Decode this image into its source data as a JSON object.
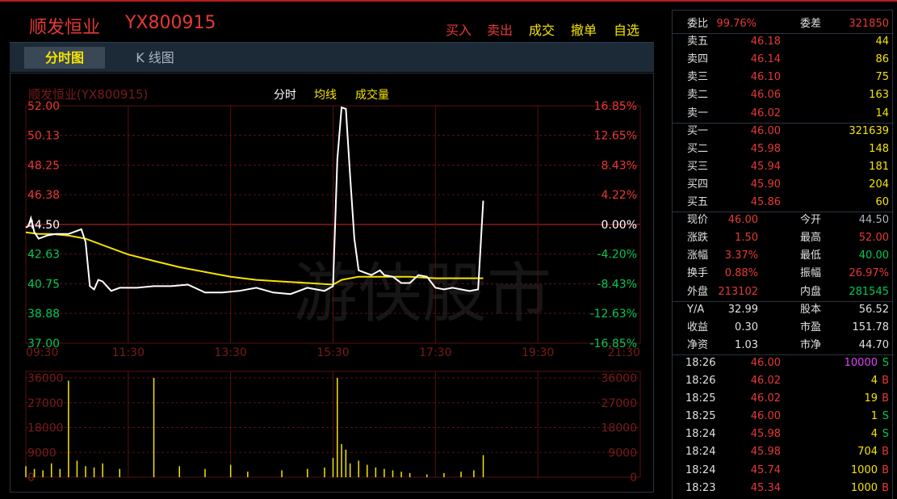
{
  "header": {
    "stock_name": "顺发恒业",
    "stock_code": "YX800915",
    "buttons": [
      {
        "label": "买入",
        "color": "#e53935"
      },
      {
        "label": "卖出",
        "color": "#e53935"
      },
      {
        "label": "成交",
        "color": "#f5e400"
      },
      {
        "label": "撤单",
        "color": "#f5e400"
      },
      {
        "label": "自选",
        "color": "#f5e400"
      }
    ]
  },
  "tabs": [
    {
      "label": "分时图",
      "active": true
    },
    {
      "label": "K 线图",
      "active": false
    }
  ],
  "chart": {
    "watermark_title": "顺发恒业(YX800915)",
    "legend": {
      "time": "分时",
      "avg": "均线",
      "volume": "成交量"
    },
    "background_watermark": "游侠股市",
    "price_ticks": [
      "52.00",
      "50.13",
      "48.25",
      "46.38",
      "44.50",
      "42.63",
      "40.75",
      "38.88",
      "37.00"
    ],
    "pct_ticks": [
      "16.85%",
      "12.65%",
      "8.43%",
      "4.22%",
      "0.00%",
      "-4.20%",
      "-8.43%",
      "-12.63%",
      "-16.85%"
    ],
    "time_ticks": [
      "09:30",
      "11:30",
      "13:30",
      "15:30",
      "17:30",
      "19:30",
      "21:30"
    ],
    "volume_ticks": [
      "36000",
      "27000",
      "18000",
      "9000",
      "0"
    ],
    "colors": {
      "up": "#e53935",
      "down": "#00c853",
      "price_line": "#ffffff",
      "avg_line": "#f5e400",
      "grid": "#5a1010"
    }
  },
  "chart_data": {
    "type": "line",
    "title": "",
    "xlabel": "",
    "ylabel": "",
    "prev_close": 44.5,
    "ylim": [
      37.0,
      52.0
    ],
    "x_range": [
      "09:30",
      "21:30"
    ],
    "series": [
      {
        "name": "分时",
        "x": [
          "09:30",
          "09:33",
          "09:36",
          "09:40",
          "09:45",
          "09:55",
          "10:05",
          "10:20",
          "10:35",
          "10:40",
          "10:45",
          "10:50",
          "10:55",
          "11:00",
          "11:10",
          "11:20",
          "11:40",
          "12:00",
          "12:20",
          "12:40",
          "13:00",
          "13:20",
          "13:40",
          "14:00",
          "14:20",
          "14:40",
          "15:00",
          "15:20",
          "15:30",
          "15:35",
          "15:40",
          "15:45",
          "15:50",
          "15:55",
          "16:00",
          "16:05",
          "16:15",
          "16:25",
          "16:30",
          "16:40",
          "16:50",
          "17:00",
          "17:10",
          "17:20",
          "17:30",
          "17:40",
          "17:50",
          "18:00",
          "18:10",
          "18:20",
          "18:26"
        ],
        "values": [
          44.3,
          44.4,
          44.9,
          44.0,
          43.6,
          43.8,
          43.9,
          43.9,
          44.2,
          43.4,
          40.6,
          40.4,
          41.0,
          40.9,
          40.3,
          40.5,
          40.5,
          40.6,
          40.6,
          40.7,
          40.2,
          40.2,
          40.3,
          40.5,
          40.2,
          40.1,
          40.5,
          40.3,
          40.6,
          48.6,
          51.9,
          51.8,
          47.6,
          43.6,
          41.6,
          41.5,
          41.3,
          41.6,
          41.3,
          41.2,
          40.8,
          40.8,
          41.3,
          41.2,
          40.5,
          40.4,
          40.5,
          40.4,
          40.3,
          40.4,
          46.0
        ]
      },
      {
        "name": "均线",
        "x": [
          "09:30",
          "09:45",
          "10:00",
          "10:20",
          "10:40",
          "11:00",
          "11:30",
          "12:00",
          "12:30",
          "13:00",
          "13:30",
          "14:00",
          "14:30",
          "15:00",
          "15:30",
          "15:40",
          "16:00",
          "16:30",
          "17:00",
          "17:30",
          "18:00",
          "18:26"
        ],
        "values": [
          44.0,
          43.9,
          43.9,
          43.8,
          43.6,
          43.2,
          42.6,
          42.2,
          41.8,
          41.5,
          41.2,
          41.0,
          40.9,
          40.8,
          40.7,
          41.0,
          41.2,
          41.2,
          41.2,
          41.1,
          41.1,
          41.1
        ]
      }
    ],
    "volume": {
      "ylim": [
        0,
        36000
      ],
      "x": [
        "09:30",
        "09:40",
        "09:50",
        "10:00",
        "10:10",
        "10:20",
        "10:30",
        "10:40",
        "10:50",
        "11:00",
        "11:20",
        "12:00",
        "12:30",
        "13:00",
        "13:30",
        "13:50",
        "14:30",
        "15:00",
        "15:20",
        "15:30",
        "15:35",
        "15:40",
        "15:45",
        "15:50",
        "16:00",
        "16:10",
        "16:20",
        "16:30",
        "16:40",
        "16:50",
        "17:00",
        "17:20",
        "17:40",
        "18:00",
        "18:15",
        "18:26"
      ],
      "values": [
        4000,
        3000,
        2500,
        5000,
        3000,
        35000,
        6000,
        4000,
        3500,
        5000,
        3000,
        36000,
        4000,
        3000,
        4500,
        2000,
        2500,
        3000,
        3500,
        7000,
        36000,
        12000,
        10000,
        5000,
        6000,
        4500,
        3500,
        3000,
        2500,
        2000,
        1500,
        1000,
        1500,
        2000,
        2500,
        8000
      ]
    }
  },
  "order_book": {
    "committee": {
      "ratio_label": "委比",
      "ratio": "99.76%",
      "diff_label": "委差",
      "diff": "321850"
    },
    "sells": [
      {
        "label": "卖五",
        "price": "46.18",
        "vol": "44"
      },
      {
        "label": "卖四",
        "price": "46.14",
        "vol": "86"
      },
      {
        "label": "卖三",
        "price": "46.10",
        "vol": "75"
      },
      {
        "label": "卖二",
        "price": "46.06",
        "vol": "163"
      },
      {
        "label": "卖一",
        "price": "46.02",
        "vol": "14"
      }
    ],
    "buys": [
      {
        "label": "买一",
        "price": "46.00",
        "vol": "321639"
      },
      {
        "label": "买二",
        "price": "45.98",
        "vol": "148"
      },
      {
        "label": "买三",
        "price": "45.94",
        "vol": "181"
      },
      {
        "label": "买四",
        "price": "45.90",
        "vol": "204"
      },
      {
        "label": "买五",
        "price": "45.86",
        "vol": "60"
      }
    ]
  },
  "quote": [
    {
      "l1": "现价",
      "v1": "46.00",
      "c1": "#e53935",
      "l2": "今开",
      "v2": "44.50",
      "c2": "#aab4be"
    },
    {
      "l1": "涨跌",
      "v1": "1.50",
      "c1": "#e53935",
      "l2": "最高",
      "v2": "52.00",
      "c2": "#e53935"
    },
    {
      "l1": "涨幅",
      "v1": "3.37%",
      "c1": "#e53935",
      "l2": "最低",
      "v2": "40.00",
      "c2": "#00c853"
    },
    {
      "l1": "换手",
      "v1": "0.88%",
      "c1": "#e53935",
      "l2": "振幅",
      "v2": "26.97%",
      "c2": "#e53935"
    },
    {
      "l1": "外盘",
      "v1": "213102",
      "c1": "#e53935",
      "l2": "内盘",
      "v2": "281545",
      "c2": "#00c853"
    }
  ],
  "fundamentals": [
    {
      "l1": "Y/A",
      "v1": "32.99",
      "l2": "股本",
      "v2": "56.52"
    },
    {
      "l1": "收益",
      "v1": "0.30",
      "l2": "市盈",
      "v2": "151.78"
    },
    {
      "l1": "净资",
      "v1": "1.03",
      "l2": "市净",
      "v2": "44.70"
    }
  ],
  "trades": [
    {
      "time": "18:26",
      "price": "46.00",
      "vol": "10000",
      "side": "S",
      "vol_color": "#e040fb"
    },
    {
      "time": "18:26",
      "price": "46.02",
      "vol": "4",
      "side": "B",
      "vol_color": "#f5e400"
    },
    {
      "time": "18:25",
      "price": "46.02",
      "vol": "19",
      "side": "B",
      "vol_color": "#f5e400"
    },
    {
      "time": "18:25",
      "price": "46.00",
      "vol": "1",
      "side": "S",
      "vol_color": "#f5e400"
    },
    {
      "time": "18:24",
      "price": "45.98",
      "vol": "4",
      "side": "S",
      "vol_color": "#f5e400"
    },
    {
      "time": "18:24",
      "price": "45.98",
      "vol": "704",
      "side": "B",
      "vol_color": "#f5e400"
    },
    {
      "time": "18:24",
      "price": "45.74",
      "vol": "1000",
      "side": "B",
      "vol_color": "#f5e400"
    },
    {
      "time": "18:23",
      "price": "45.34",
      "vol": "1000",
      "side": "B",
      "vol_color": "#f5e400"
    }
  ]
}
